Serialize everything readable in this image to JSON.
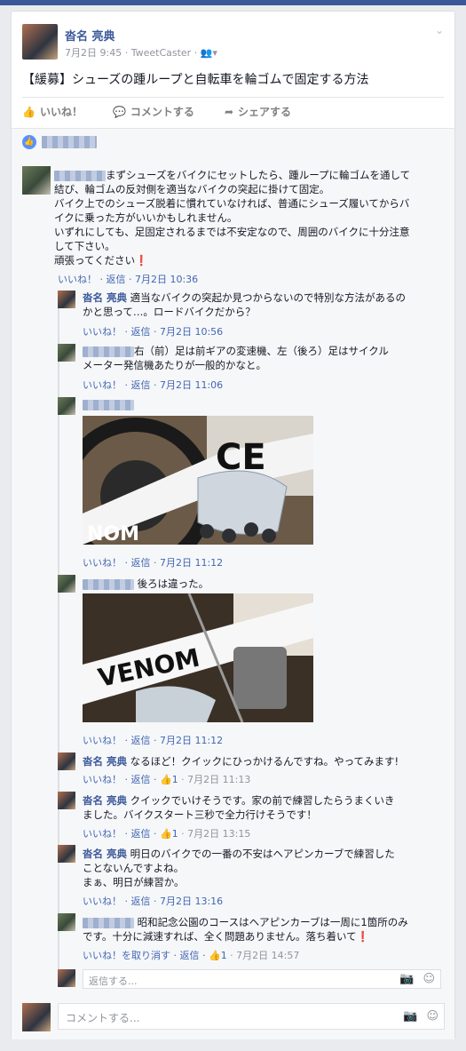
{
  "post": {
    "author": "沓名 亮典",
    "date": "7月2日 9:45",
    "via": "· TweetCaster ·",
    "text": "【緩募】シューズの踵ループと自転車を輪ゴムで固定する方法",
    "audience_icon": "friends-icon"
  },
  "actions": {
    "like": "いいね！",
    "comment": "コメントする",
    "share": "シェアする"
  },
  "comments": [
    {
      "lines": [
        "まずシューズをバイクにセットしたら、踵ループに輪ゴムを通して",
        "結び、輪ゴムの反対側を適当なバイクの突起に掛けて固定。",
        "バイク上でのシューズ脱着に慣れていなければ、普通にシューズ履いてからバ",
        "イクに乗った方がいいかもしれません。",
        "いずれにしても、足固定されるまでは不安定なので、周囲のバイクに十分注意",
        "して下さい。",
        "頑張ってください"
      ],
      "footer": "いいね！ · 返信 · 7月2日 10:36"
    }
  ],
  "replies": [
    {
      "author": "沓名 亮典",
      "lines": [
        "適当なバイクの突起か見つからないので特別な方法があるの",
        "かと思って…。ロードバイクだから？"
      ],
      "footer": "いいね！ · 返信 · 7月2日 10:56"
    },
    {
      "lines": [
        "右（前）足は前ギアの変速機、左（後ろ）足はサイクル",
        "メーター発信機あたりが一般的かなと。"
      ],
      "footer": "いいね！ · 返信 · 7月2日 11:06"
    },
    {
      "footer": "いいね！ · 返信 · 7月2日 11:12"
    },
    {
      "text": "後ろは違った。",
      "footer": "いいね！ · 返信 · 7月2日 11:12"
    },
    {
      "author": "沓名 亮典",
      "text": "なるほど！クイックにひっかけるんですね。やってみます!",
      "footer_pre": "いいね！ · 返信 · ",
      "likes": "1",
      "footer_post": " · 7月2日 11:13"
    },
    {
      "author": "沓名 亮典",
      "lines": [
        "クイックでいけそうです。家の前で練習したらうまくいき",
        "ました。バイクスタート三秒で全力行けそうです！"
      ],
      "footer_pre": "いいね！ · 返信 · ",
      "likes": "1",
      "footer_post": " · 7月2日 13:15"
    },
    {
      "author": "沓名 亮典",
      "lines": [
        "明日のバイクでの一番の不安はヘアピンカーブで練習した",
        "ことないんですよね。",
        "まぁ、明日が練習か。"
      ],
      "footer": "いいね！ · 返信 · 7月2日 13:16"
    },
    {
      "lines": [
        "昭和記念公園のコースはヘアピンカーブは一周に1箇所のみ",
        "です。十分に減速すれば、全く問題ありません。落ち着いて"
      ],
      "footer_pre": "いいね！を取り消す · 返信 · ",
      "likes": "1",
      "footer_post": " · 7月2日 14:57"
    }
  ],
  "reply_placeholder": "返信する...",
  "comment_placeholder": "コメントする...",
  "colors": {
    "brand": "#3b5998",
    "link": "#4267b2",
    "like_blue": "#5890ff"
  }
}
